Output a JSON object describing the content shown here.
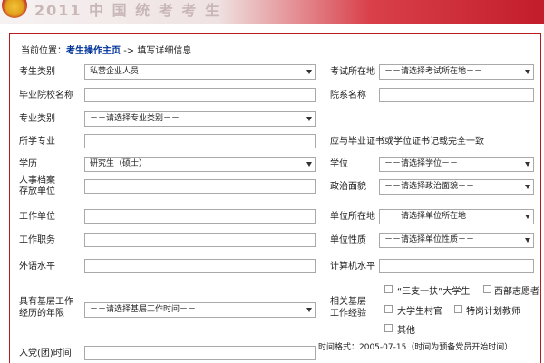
{
  "breadcrumb": {
    "prefix": "当前位置：",
    "home": "考生操作主页",
    "sep": "->",
    "current": "填写详细信息"
  },
  "fields": {
    "candidate_type": {
      "label": "考生类别",
      "value": "私营企业人员"
    },
    "exam_location": {
      "label": "考试所在地",
      "value": "－－请选择考试所在地－－"
    },
    "grad_school": {
      "label": "毕业院校名称",
      "value": ""
    },
    "dept_name": {
      "label": "院系名称",
      "value": ""
    },
    "major_type": {
      "label": "专业类别",
      "value": "－－请选择专业类别－－"
    },
    "major": {
      "label": "所学专业",
      "value": ""
    },
    "cert_note": "应与毕业证书或学位证书记载完全一致",
    "education": {
      "label": "学历",
      "value": "研究生（硕士）"
    },
    "degree": {
      "label": "学位",
      "value": "－－请选择学位－－"
    },
    "archive_label_1": "人事档案",
    "archive_label_2": "存放单位",
    "archive_unit": {
      "value": ""
    },
    "politics": {
      "label": "政治面貌",
      "value": "－－请选择政治面貌－－"
    },
    "work_unit": {
      "label": "工作单位",
      "value": ""
    },
    "unit_location": {
      "label": "单位所在地",
      "value": "－－请选择单位所在地－－"
    },
    "job_title": {
      "label": "工作职务",
      "value": ""
    },
    "unit_nature": {
      "label": "单位性质",
      "value": "－－请选择单位性质－－"
    },
    "foreign_lang": {
      "label": "外语水平",
      "value": ""
    },
    "computer_level": {
      "label": "计算机水平",
      "value": ""
    },
    "grassroots_label_1": "具有基层工作",
    "grassroots_label_2": "经历的年限",
    "grassroots_years": {
      "value": "－－请选择基层工作时间－－"
    },
    "related_label_1": "相关基层",
    "related_label_2": "工作经验",
    "related_options": [
      "“三支一扶”大学生",
      "西部志愿者",
      "大学生村官",
      "特岗计划教师",
      "其他"
    ],
    "party_date": {
      "label": "入党(团)时间",
      "value": ""
    },
    "time_format": "时间格式：2005-07-15（时间为预备党员开始时间）"
  }
}
